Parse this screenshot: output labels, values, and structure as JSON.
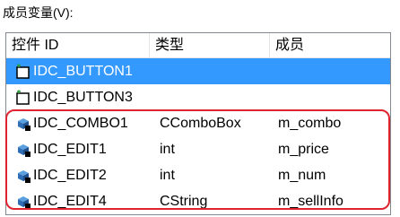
{
  "title": "成员变量(V):",
  "columns": [
    "控件 ID",
    "类型",
    "成员"
  ],
  "rows": [
    {
      "id": "IDC_BUTTON1",
      "type": "",
      "member": "",
      "icon": "button-control-icon",
      "selected": true
    },
    {
      "id": "IDC_BUTTON3",
      "type": "",
      "member": "",
      "icon": "button-control-icon",
      "selected": false
    },
    {
      "id": "IDC_COMBO1",
      "type": "CComboBox",
      "member": "m_combo",
      "icon": "variable-bound-icon",
      "selected": false
    },
    {
      "id": "IDC_EDIT1",
      "type": "int",
      "member": "m_price",
      "icon": "variable-bound-icon",
      "selected": false
    },
    {
      "id": "IDC_EDIT2",
      "type": "int",
      "member": "m_num",
      "icon": "variable-bound-icon",
      "selected": false
    },
    {
      "id": "IDC_EDIT4",
      "type": "CString",
      "member": "m_sellInfo",
      "icon": "variable-bound-icon",
      "selected": false
    }
  ],
  "colors": {
    "selection": "#3399ff",
    "highlight_border": "#e0242f"
  }
}
